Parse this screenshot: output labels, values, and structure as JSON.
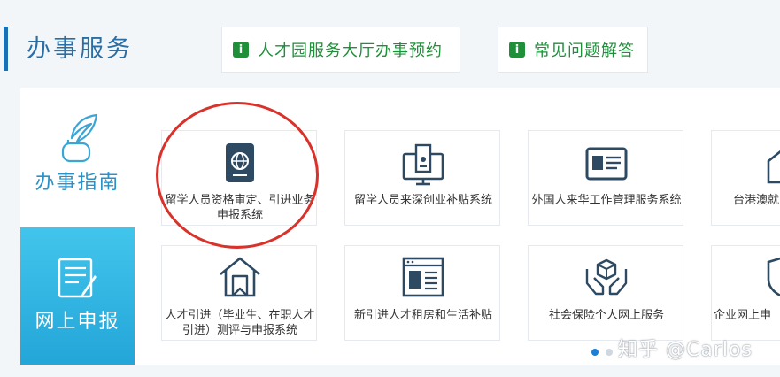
{
  "header": {
    "title": "办事服务",
    "quick_links": [
      {
        "icon": "info-icon",
        "icon_glyph": "i",
        "label": "人才园服务大厅办事预约"
      },
      {
        "icon": "info-icon",
        "icon_glyph": "i",
        "label": "常见问题解答"
      }
    ]
  },
  "sidebar": {
    "tabs": [
      {
        "label": "办事指南",
        "icon": "quill-ink-icon",
        "active": false
      },
      {
        "label": "网上申报",
        "icon": "document-pen-icon",
        "active": true
      }
    ]
  },
  "services": [
    {
      "label": "留学人员资格审定、引进业务申报系统",
      "icon": "passport-globe-icon"
    },
    {
      "label": "留学人员来深创业补贴系统",
      "icon": "monitor-certificate-icon"
    },
    {
      "label": "外国人来华工作管理服务系统",
      "icon": "id-card-icon"
    },
    {
      "label": "台港澳就",
      "icon": "house-icon"
    },
    {
      "label": "人才引进（毕业生、在职人才引进）测评与申报系统",
      "icon": "house-bookmark-icon"
    },
    {
      "label": "新引进人才租房和生活补贴",
      "icon": "browser-window-icon"
    },
    {
      "label": "社会保险个人网上服务",
      "icon": "hands-box-icon"
    },
    {
      "label": "企业网上申",
      "icon": "shield-icon"
    }
  ],
  "pagination": {
    "pages": 2,
    "current": 1
  },
  "watermark": "知乎 @Carlos",
  "colors": {
    "accent": "#1b6fb3",
    "green": "#1f8f3a",
    "icon": "#2d4a62",
    "highlight_circle": "#d8322b",
    "active_tab": "#2aaee0"
  }
}
